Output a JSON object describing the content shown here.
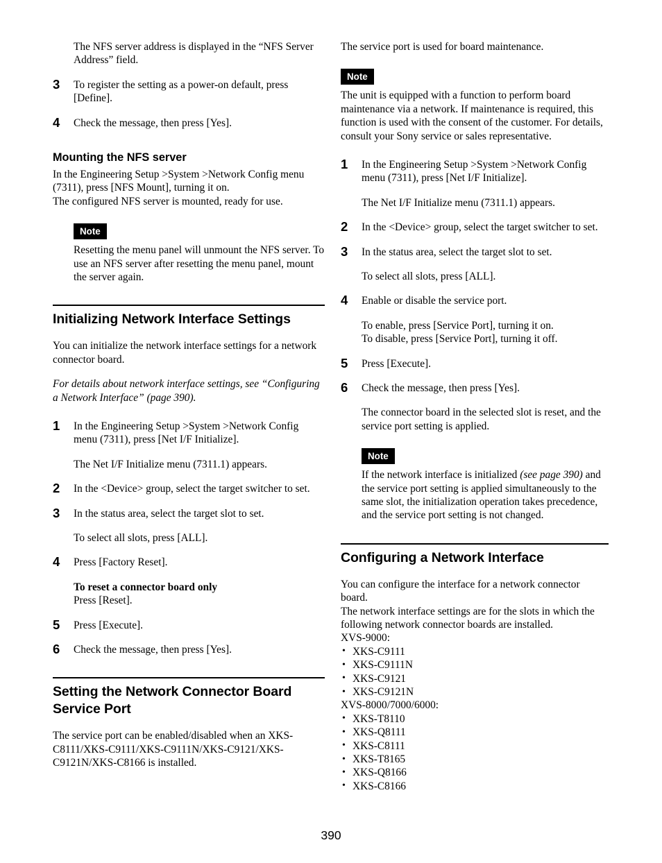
{
  "page": {
    "number": "390"
  },
  "left_column": {
    "intro_paragraph": "The NFS server address is displayed in the “NFS Server Address” field.",
    "steps_top": [
      {
        "num": "3",
        "text": "To register the setting as a power-on default, press [Define]."
      },
      {
        "num": "4",
        "text": "Check the message, then press [Yes]."
      }
    ],
    "mounting_section": {
      "heading": "Mounting the NFS server",
      "body_line_1": "In the Engineering Setup >System >Network Config menu (7311), press [NFS Mount], turning it on.",
      "body_line_2": "The configured NFS server is mounted, ready for use.",
      "note_label": "Note",
      "note_text": "Resetting the menu panel will unmount the NFS server. To use an NFS server after resetting the menu panel, mount the server again."
    },
    "initializing_section": {
      "heading": "Initializing Network Interface Settings",
      "intro": "You can initialize the network interface settings for a network connector board.",
      "cross_reference": "For details about network interface settings, see “Configuring a Network Interface” (page 390).",
      "steps": [
        {
          "num": "1",
          "text": "In the Engineering Setup >System >Network Config menu (7311), press [Net I/F Initialize]."
        },
        {
          "num": "1b",
          "text": "The Net I/F Initialize menu (7311.1) appears."
        },
        {
          "num": "2",
          "text": "In the <Device> group, select the target switcher to set."
        },
        {
          "num": "3",
          "text": "In the status area, select the target slot to set."
        },
        {
          "num": "3b",
          "text": "To select all slots, press [ALL]."
        },
        {
          "num": "4",
          "text": "Press [Factory Reset]."
        },
        {
          "num": "4b_bold",
          "text": "To reset a connector board only"
        },
        {
          "num": "4b",
          "text": "Press [Reset]."
        },
        {
          "num": "5",
          "text": "Press [Execute]."
        },
        {
          "num": "6",
          "text": "Check the message, then press [Yes]."
        }
      ]
    },
    "service_port_section": {
      "heading": "Setting the Network Connector Board Service Port",
      "intro": "The service port can be enabled/disabled when an XKS-C8111/XKS-C9111/XKS-C9111N/XKS-C9121/XKS-C9121N/XKS-C8166 is installed."
    }
  },
  "right_column": {
    "service_port_intro": "The service port is used for board maintenance.",
    "note_1_label": "Note",
    "note_1_text": "The unit is equipped with a function to perform board maintenance via a network. If maintenance is required, this function is used with the consent of the customer. For details, consult your Sony service or sales representative.",
    "steps": [
      {
        "num": "1",
        "text": "In the Engineering Setup >System >Network Config menu (7311), press [Net I/F Initialize]."
      },
      {
        "num": "1b",
        "text": "The Net I/F Initialize menu (7311.1) appears."
      },
      {
        "num": "2",
        "text": "In the <Device> group, select the target switcher to set."
      },
      {
        "num": "3",
        "text": "In the status area, select the target slot to set."
      },
      {
        "num": "3b",
        "text": "To select all slots, press [ALL]."
      },
      {
        "num": "4",
        "text": "Enable or disable the service port."
      },
      {
        "num": "4b_line1",
        "text": "To enable, press [Service Port], turning it on."
      },
      {
        "num": "4b_line2",
        "text": "To disable, press [Service Port], turning it off."
      },
      {
        "num": "5",
        "text": "Press [Execute]."
      },
      {
        "num": "6",
        "text": "Check the message, then press [Yes]."
      },
      {
        "num": "6b",
        "text": "The connector board in the selected slot is reset, and the service port setting is applied."
      }
    ],
    "note_2_label": "Note",
    "note_2_part_1": "If the network interface is initialized ",
    "note_2_italic": "(see page 390)",
    "note_2_part_2": " and the service port setting is applied simultaneously to the same slot, the initialization operation takes precedence, and the service port setting is not changed.",
    "configuring_section": {
      "heading": "Configuring a Network Interface",
      "intro_line_1": "You can configure the interface for a network connector board.",
      "intro_line_2": "The network interface settings are for the slots in which the following network connector boards are installed.",
      "group_1_label": "XVS-9000:",
      "group_1_items": [
        "XKS-C9111",
        "XKS-C9111N",
        "XKS-C9121",
        "XKS-C9121N"
      ],
      "group_2_label": "XVS-8000/7000/6000:",
      "group_2_items": [
        "XKS-T8110",
        "XKS-Q8111",
        "XKS-C8111",
        "XKS-T8165",
        "XKS-Q8166",
        "XKS-C8166"
      ]
    }
  }
}
